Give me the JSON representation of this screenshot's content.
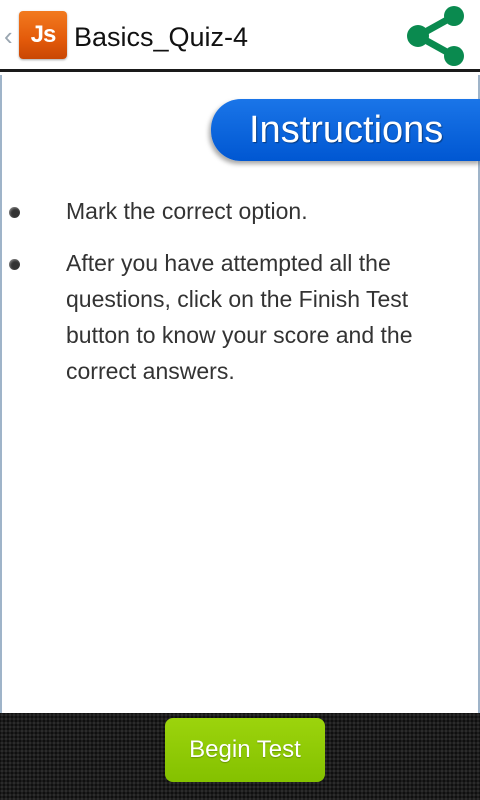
{
  "app_bar": {
    "title": "Basics_Quiz-4",
    "logo_text": "Js",
    "logo_color": "#e35a0a",
    "share_icon": "share-icon",
    "share_color": "#0a8a4f"
  },
  "content": {
    "banner": "Instructions",
    "banner_color": "#0a5fd6",
    "items": [
      "Mark the correct option.",
      "After you have attempted all the questions, click on the Finish Test button to know your score and the correct answers."
    ]
  },
  "bottom_bar": {
    "begin_label": "Begin Test",
    "begin_color": "#8bc600"
  }
}
